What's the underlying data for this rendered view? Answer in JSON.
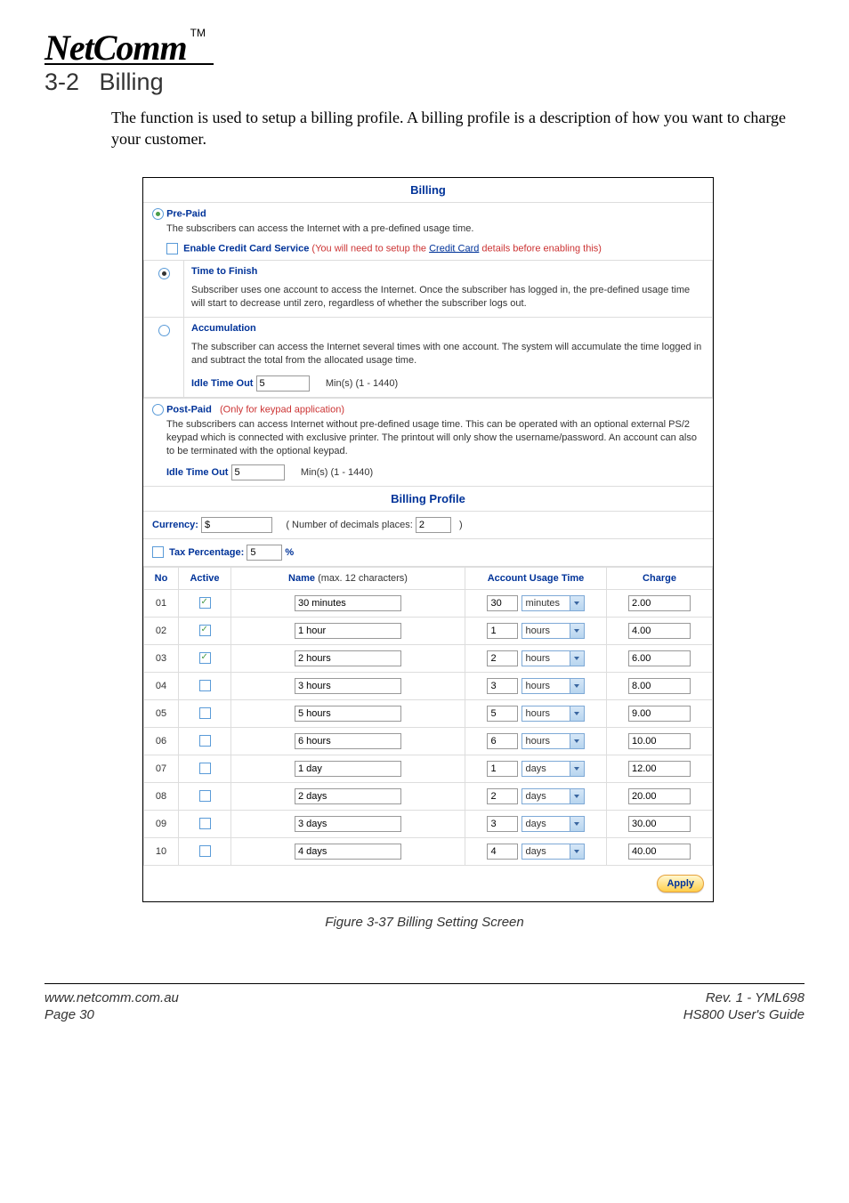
{
  "logo": {
    "text": "NetComm",
    "tm": "TM"
  },
  "section": {
    "number": "3-2",
    "title": "Billing",
    "body": "The function is used to setup a billing profile. A billing profile is a description of how you want to charge your customer."
  },
  "billing": {
    "title": "Billing",
    "prepaid": {
      "label": "Pre-Paid",
      "desc": "The subscribers can access the Internet with a pre-defined usage time.",
      "creditLabel": "Enable Credit Card Service",
      "creditDesc1": "(You will need to setup the ",
      "creditLink": "Credit Card",
      "creditDesc2": " details before enabling this)",
      "timeToFinish": {
        "label": "Time to Finish",
        "desc": "Subscriber uses one account to access the Internet.  Once the subscriber has logged in, the pre-defined usage time will start to decrease until zero, regardless of whether the subscriber logs out."
      },
      "accumulation": {
        "label": "Accumulation",
        "desc": "The subscriber can access the Internet several times with one account. The system will accumulate the time logged in and subtract the total from the allocated usage time.",
        "idleLabel": "Idle Time Out",
        "idleValue": "5",
        "idleRange": "Min(s) (1 - 1440)"
      }
    },
    "postpaid": {
      "label": "Post-Paid",
      "suffix": "(Only for keypad application)",
      "desc": "The subscribers can access Internet without pre-defined usage time. This can be operated with an optional external PS/2 keypad which is connected with exclusive printer. The printout will only show the username/password. An account can also to be terminated with the optional keypad.",
      "idleLabel": "Idle Time Out",
      "idleValue": "5",
      "idleRange": "Min(s) (1 - 1440)"
    }
  },
  "profile": {
    "title": "Billing Profile",
    "currencyLabel": "Currency:",
    "currencyValue": "$",
    "decimalsLabel": "( Number of decimals places:",
    "decimalsValue": "2",
    "decimalsClose": ")",
    "taxLabel": "Tax Percentage:",
    "taxValue": "5",
    "taxSuffix": "%",
    "headers": {
      "no": "No",
      "active": "Active",
      "name": "Name",
      "nameSuffix": "(max. 12 characters)",
      "usage": "Account Usage Time",
      "charge": "Charge"
    },
    "rows": [
      {
        "no": "01",
        "active": true,
        "name": "30 minutes",
        "qty": "30",
        "unit": "minutes",
        "charge": "2.00"
      },
      {
        "no": "02",
        "active": true,
        "name": "1 hour",
        "qty": "1",
        "unit": "hours",
        "charge": "4.00"
      },
      {
        "no": "03",
        "active": true,
        "name": "2 hours",
        "qty": "2",
        "unit": "hours",
        "charge": "6.00"
      },
      {
        "no": "04",
        "active": false,
        "name": "3 hours",
        "qty": "3",
        "unit": "hours",
        "charge": "8.00"
      },
      {
        "no": "05",
        "active": false,
        "name": "5 hours",
        "qty": "5",
        "unit": "hours",
        "charge": "9.00"
      },
      {
        "no": "06",
        "active": false,
        "name": "6 hours",
        "qty": "6",
        "unit": "hours",
        "charge": "10.00"
      },
      {
        "no": "07",
        "active": false,
        "name": "1 day",
        "qty": "1",
        "unit": "days",
        "charge": "12.00"
      },
      {
        "no": "08",
        "active": false,
        "name": "2 days",
        "qty": "2",
        "unit": "days",
        "charge": "20.00"
      },
      {
        "no": "09",
        "active": false,
        "name": "3 days",
        "qty": "3",
        "unit": "days",
        "charge": "30.00"
      },
      {
        "no": "10",
        "active": false,
        "name": "4 days",
        "qty": "4",
        "unit": "days",
        "charge": "40.00"
      }
    ],
    "applyLabel": "Apply"
  },
  "figure": {
    "caption": "Figure 3-37 Billing Setting Screen"
  },
  "footer": {
    "url": "www.netcomm.com.au",
    "page": "Page 30",
    "rev": "Rev. 1 - YML698",
    "guide": "HS800 User's Guide"
  }
}
